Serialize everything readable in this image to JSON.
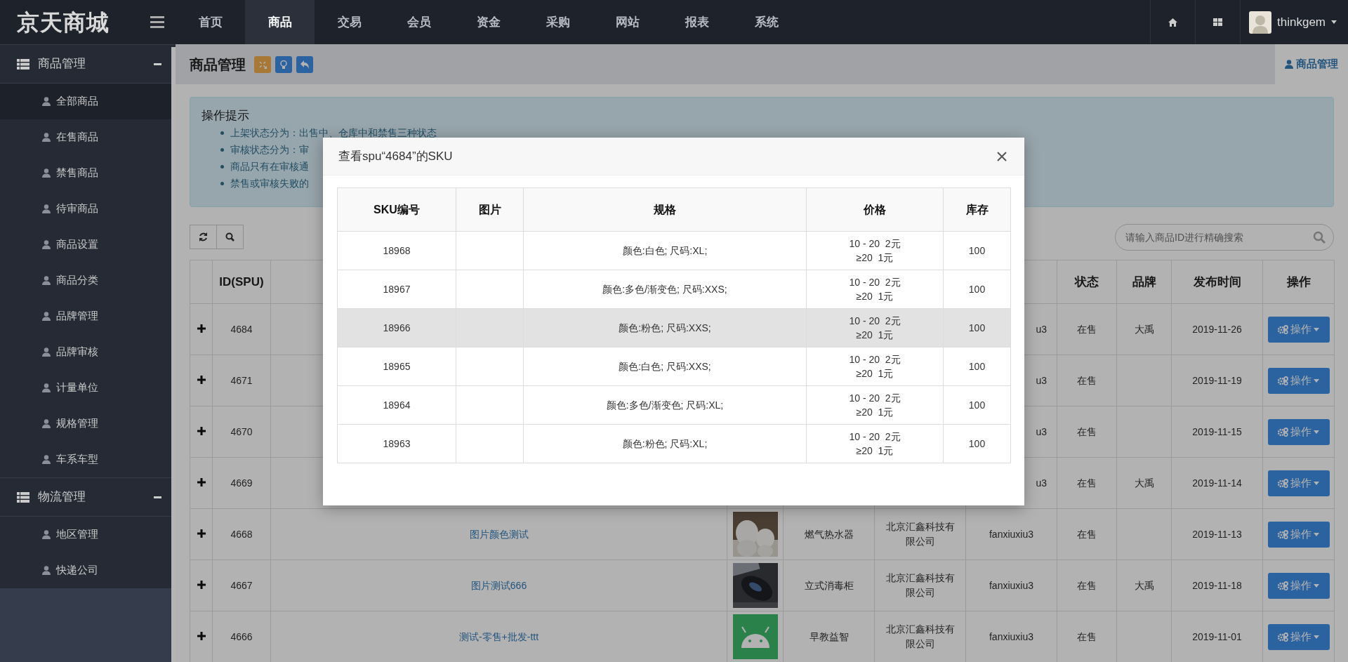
{
  "brand": "京天商城",
  "top_nav": [
    {
      "label": "首页",
      "selected": false
    },
    {
      "label": "商品",
      "selected": true
    },
    {
      "label": "交易",
      "selected": false
    },
    {
      "label": "会员",
      "selected": false
    },
    {
      "label": "资金",
      "selected": false
    },
    {
      "label": "采购",
      "selected": false
    },
    {
      "label": "网站",
      "selected": false
    },
    {
      "label": "报表",
      "selected": false
    },
    {
      "label": "系统",
      "selected": false
    }
  ],
  "user": {
    "name": "thinkgem"
  },
  "sidebar": {
    "groups": [
      {
        "title": "商品管理",
        "expanded": true,
        "items": [
          {
            "label": "全部商品",
            "selected": true
          },
          {
            "label": "在售商品",
            "selected": false
          },
          {
            "label": "禁售商品",
            "selected": false
          },
          {
            "label": "待审商品",
            "selected": false
          },
          {
            "label": "商品设置",
            "selected": false
          },
          {
            "label": "商品分类",
            "selected": false
          },
          {
            "label": "品牌管理",
            "selected": false
          },
          {
            "label": "品牌审核",
            "selected": false
          },
          {
            "label": "计量单位",
            "selected": false
          },
          {
            "label": "规格管理",
            "selected": false
          },
          {
            "label": "车系车型",
            "selected": false
          }
        ]
      },
      {
        "title": "物流管理",
        "expanded": true,
        "items": [
          {
            "label": "地区管理",
            "selected": false
          },
          {
            "label": "快递公司",
            "selected": false
          }
        ]
      }
    ]
  },
  "page": {
    "title": "商品管理",
    "tab": "商品管理"
  },
  "tips": {
    "title": "操作提示",
    "items": [
      "上架状态分为：出售中、仓库中和禁售三种状态",
      "审核状态分为：审",
      "商品只有在审核通",
      "禁售或审核失败的"
    ]
  },
  "search": {
    "placeholder": "请输入商品ID进行精确搜索"
  },
  "table": {
    "columns": [
      {
        "kind": "id",
        "label": "ID(SPU)"
      },
      {
        "kind": "status",
        "label": "状态"
      },
      {
        "kind": "brand",
        "label": "品牌"
      },
      {
        "kind": "date",
        "label": "发布时间"
      },
      {
        "kind": "action",
        "label": "操作"
      }
    ],
    "rows": [
      {
        "id": "4684",
        "user": "u3",
        "status": "在售",
        "brand": "大禹",
        "date": "2019-11-26",
        "action": "操作"
      },
      {
        "id": "4671",
        "user": "u3",
        "status": "在售",
        "date": "2019-11-19",
        "action": "操作"
      },
      {
        "id": "4670",
        "user": "u3",
        "status": "在售",
        "date": "2019-11-15",
        "action": "操作"
      },
      {
        "id": "4669",
        "user": "u3",
        "status": "在售",
        "brand": "大禹",
        "date": "2019-11-14",
        "action": "操作"
      },
      {
        "id": "4668",
        "name": "图片颜色测试",
        "category": "燃气热水器",
        "company": "北京汇鑫科技有限公司",
        "user": "fanxiuxiu3",
        "status": "在售",
        "date": "2019-11-13",
        "action": "操作"
      },
      {
        "id": "4667",
        "name": "图片测试666",
        "category": "立式消毒柜",
        "company": "北京汇鑫科技有限公司",
        "user": "fanxiuxiu3",
        "status": "在售",
        "brand": "大禹",
        "date": "2019-11-18",
        "action": "操作"
      },
      {
        "id": "4666",
        "name": "测试-零售+批发-ttt",
        "category": "早教益智",
        "company": "北京汇鑫科技有限公司",
        "user": "fanxiuxiu3",
        "status": "在售",
        "date": "2019-11-01",
        "action": "操作"
      }
    ]
  },
  "modal": {
    "title": "查看spu“4684”的SKU",
    "columns": [
      "SKU编号",
      "图片",
      "规格",
      "价格",
      "库存"
    ],
    "rows": [
      {
        "sku": "18968",
        "spec": "颜色:白色; 尺码:XL;",
        "price": [
          "10 - 20  2元",
          "≥20  1元"
        ],
        "stock": "100",
        "highlighted": false
      },
      {
        "sku": "18967",
        "spec": "颜色:多色/渐变色; 尺码:XXS;",
        "price": [
          "10 - 20  2元",
          "≥20  1元"
        ],
        "stock": "100",
        "highlighted": false
      },
      {
        "sku": "18966",
        "spec": "颜色:粉色; 尺码:XXS;",
        "price": [
          "10 - 20  2元",
          "≥20  1元"
        ],
        "stock": "100",
        "highlighted": true
      },
      {
        "sku": "18965",
        "spec": "颜色:白色; 尺码:XXS;",
        "price": [
          "10 - 20  2元",
          "≥20  1元"
        ],
        "stock": "100",
        "highlighted": false
      },
      {
        "sku": "18964",
        "spec": "颜色:多色/渐变色; 尺码:XL;",
        "price": [
          "10 - 20  2元",
          "≥20  1元"
        ],
        "stock": "100",
        "highlighted": false
      },
      {
        "sku": "18963",
        "spec": "颜色:粉色; 尺码:XL;",
        "price": [
          "10 - 20  2元",
          "≥20  1元"
        ],
        "stock": "100",
        "highlighted": false
      }
    ]
  }
}
